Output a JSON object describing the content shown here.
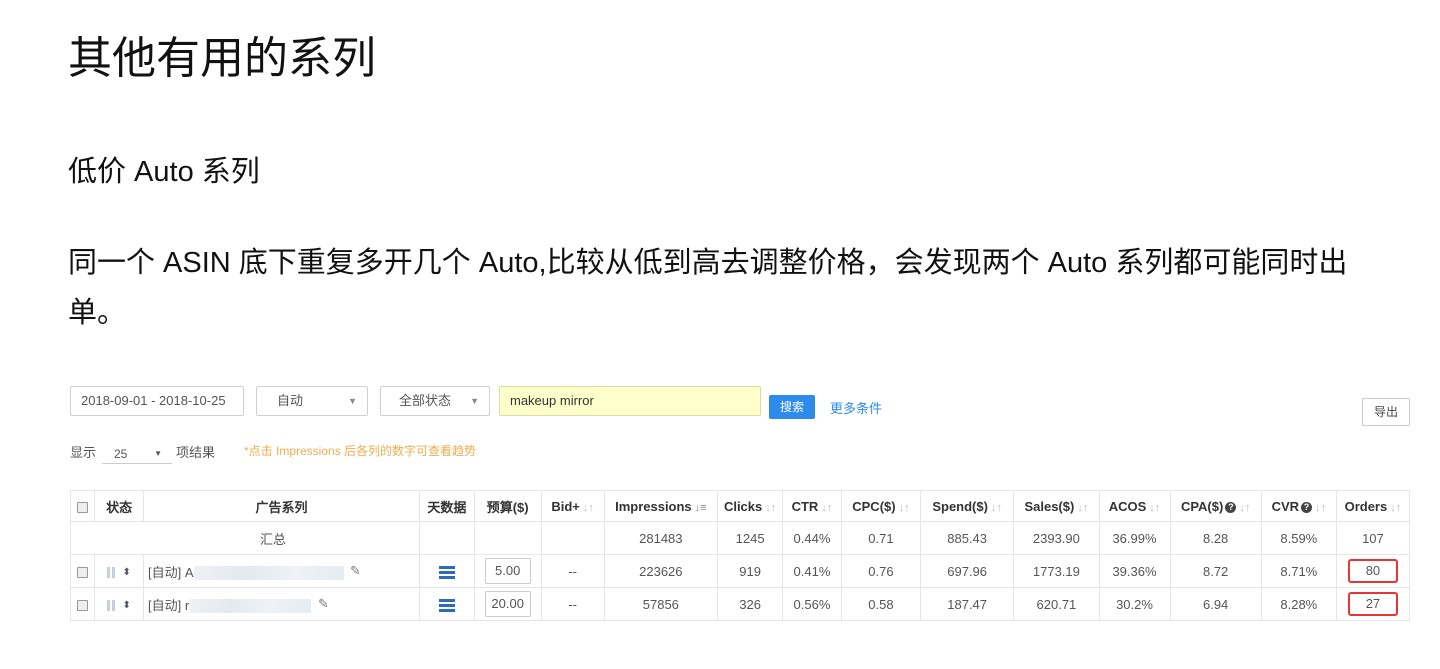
{
  "doc": {
    "title": "其他有用的系列",
    "subtitle": "低价 Auto 系列",
    "paragraph": "同一个 ASIN 底下重复多开几个 Auto,比较从低到高去调整价格，会发现两个 Auto 系列都可能同时出单。"
  },
  "toolbar": {
    "date_range": "2018-09-01 - 2018-10-25",
    "type_select": "自动",
    "status_select": "全部状态",
    "search_value": "makeup mirror",
    "search_button": "搜索",
    "more_filters": "更多条件",
    "export_button": "导出"
  },
  "show": {
    "label": "显示",
    "page_size": "25",
    "results_label": "项结果",
    "hint": "*点击 Impressions 后各列的数字可查看趋势"
  },
  "table": {
    "headers": {
      "status": "状态",
      "campaign": "广告系列",
      "daily": "天数据",
      "budget": "预算($)",
      "bid": "Bid+",
      "impressions": "Impressions",
      "clicks": "Clicks",
      "ctr": "CTR",
      "cpc": "CPC($)",
      "spend": "Spend($)",
      "sales": "Sales($)",
      "acos": "ACOS",
      "cpa": "CPA($)",
      "cvr": "CVR",
      "orders": "Orders"
    },
    "summary": {
      "label": "汇总",
      "impressions": "281483",
      "clicks": "1245",
      "ctr": "0.44%",
      "cpc": "0.71",
      "spend": "885.43",
      "sales": "2393.90",
      "acos": "36.99%",
      "cpa": "8.28",
      "cvr": "8.59%",
      "orders": "107"
    },
    "rows": [
      {
        "name": "[自动] A",
        "budget": "5.00",
        "bid": "--",
        "impressions": "223626",
        "clicks": "919",
        "ctr": "0.41%",
        "cpc": "0.76",
        "spend": "697.96",
        "sales": "1773.19",
        "acos": "39.36%",
        "cpa": "8.72",
        "cvr": "8.71%",
        "orders": "80"
      },
      {
        "name": "[自动] r",
        "budget": "20.00",
        "bid": "--",
        "impressions": "57856",
        "clicks": "326",
        "ctr": "0.56%",
        "cpc": "0.58",
        "spend": "187.47",
        "sales": "620.71",
        "acos": "30.2%",
        "cpa": "6.94",
        "cvr": "8.28%",
        "orders": "27"
      }
    ]
  },
  "colors": {
    "accent": "#2d8ceb",
    "search_bg": "#ffffcc",
    "hint": "#f0ad4e",
    "highlight": "#e53535"
  }
}
